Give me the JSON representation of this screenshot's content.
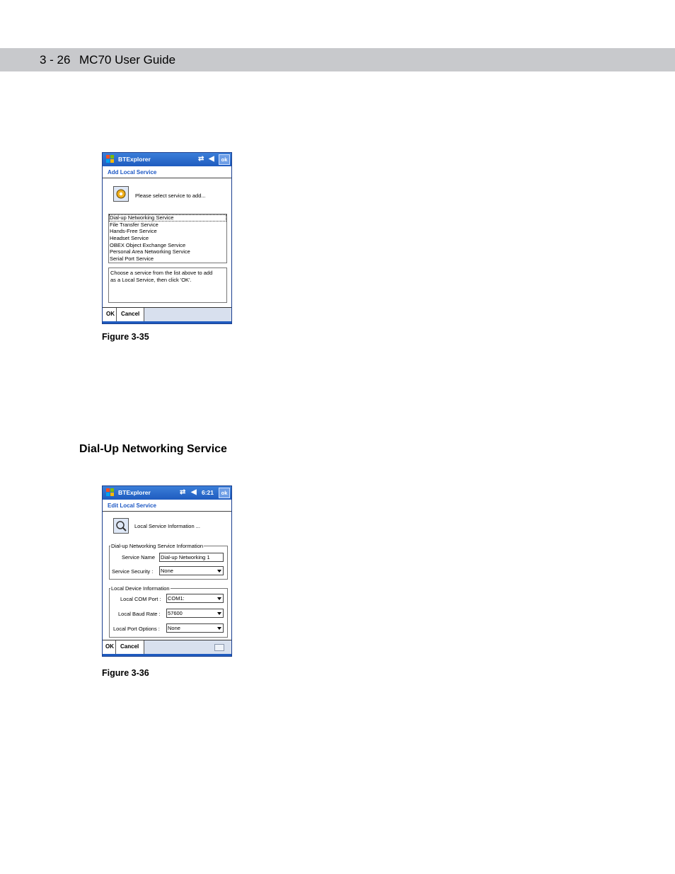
{
  "header": {
    "page_number": "3 - 26",
    "title": "MC70 User Guide"
  },
  "figure1": {
    "caption": "Figure 3-35",
    "app_title": "BTExplorer",
    "ok_label": "ok",
    "subtitle": "Add Local Service",
    "prompt": "Please select service to add...",
    "services": [
      "Dial-up Networking Service",
      "File Transfer Service",
      "Hands-Free Service",
      "Headset Service",
      "OBEX Object Exchange Service",
      "Personal Area Networking Service",
      "Serial Port Service"
    ],
    "hint_line1": "Choose a service from the list above to add",
    "hint_line2": "as a Local Service, then click 'OK'.",
    "menu_ok": "OK",
    "menu_cancel": "Cancel"
  },
  "section_heading": "Dial-Up Networking Service",
  "figure2": {
    "caption": "Figure 3-36",
    "app_title": "BTExplorer",
    "clock": "6:21",
    "ok_label": "ok",
    "subtitle": "Edit Local Service",
    "info_label": "Local Service Information ...",
    "group1_title": "Dial-up Networking Service Information",
    "service_name_label": "Service Name",
    "service_name_value": "Dial-up Networking 1",
    "service_security_label": "Service Security :",
    "service_security_value": "None",
    "group2_title": "Local Device Information",
    "com_port_label": "Local COM Port :",
    "com_port_value": "COM1:",
    "baud_rate_label": "Local Baud Rate :",
    "baud_rate_value": "57600",
    "port_options_label": "Local Port Options :",
    "port_options_value": "None",
    "menu_ok": "OK",
    "menu_cancel": "Cancel"
  }
}
